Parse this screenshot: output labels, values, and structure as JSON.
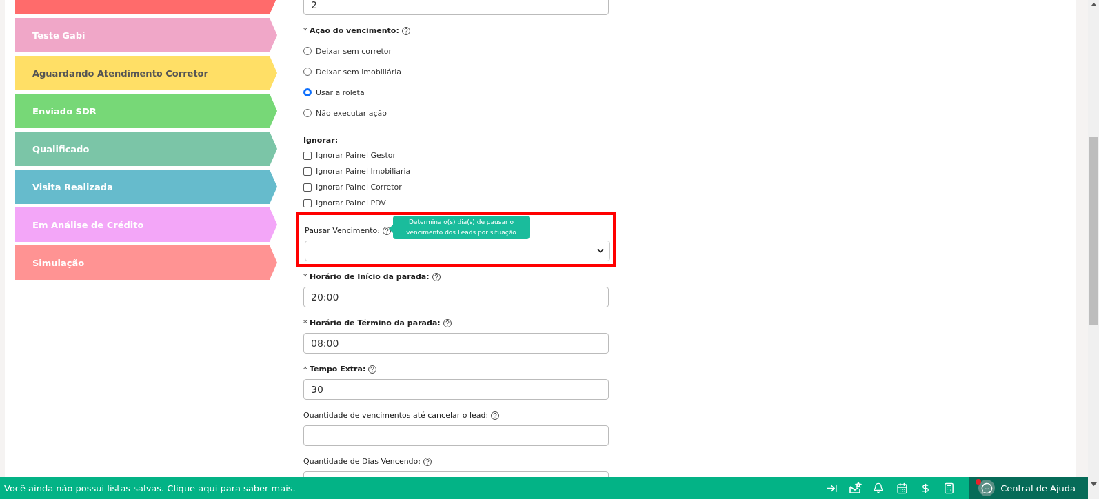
{
  "sidebar": {
    "items": [
      {
        "color": "#ff6b6b"
      },
      {
        "label": "Teste Gabi",
        "color": "#f0a7c8"
      },
      {
        "label": "Aguardando Atendimento Corretor",
        "color": "#ffdf66"
      },
      {
        "label": "Enviado SDR",
        "color": "#77d877"
      },
      {
        "label": "Qualificado",
        "color": "#7bc5a7"
      },
      {
        "label": "Visita Realizada",
        "color": "#66bbcc"
      },
      {
        "label": "Em Análise de Crédito",
        "color": "#f3a6f8"
      },
      {
        "label": "Simulação",
        "color": "#ff9393"
      }
    ]
  },
  "form": {
    "top_field": {
      "value": "2"
    },
    "action": {
      "required_mark": "*",
      "label": "Ação do vencimento:",
      "options": [
        {
          "label": "Deixar sem corretor",
          "selected": false
        },
        {
          "label": "Deixar sem imobiliária",
          "selected": false
        },
        {
          "label": "Usar a roleta",
          "selected": true
        },
        {
          "label": "Não executar ação",
          "selected": false
        }
      ]
    },
    "ignore": {
      "label": "Ignorar:",
      "options": [
        {
          "label": "Ignorar Painel Gestor",
          "checked": false
        },
        {
          "label": "Ignorar Painel Imobiliaria",
          "checked": false
        },
        {
          "label": "Ignorar Painel Corretor",
          "checked": false
        },
        {
          "label": "Ignorar Painel PDV",
          "checked": false
        }
      ]
    },
    "pause": {
      "label": "Pausar Vencimento:",
      "tooltip": "Determina o(s) dia(s) de pausar o vencimento dos Leads por situação",
      "highlighted": true
    },
    "fields": [
      {
        "required_mark": "*",
        "label": "Horário de Início da parada:",
        "value": "20:00"
      },
      {
        "required_mark": "*",
        "label": "Horário de Término da parada:",
        "value": "08:00"
      },
      {
        "required_mark": "*",
        "label": "Tempo Extra:",
        "value": "30"
      },
      {
        "label": "Quantidade de vencimentos até cancelar o lead:"
      },
      {
        "label": "Quantidade de Dias Vencendo:"
      }
    ]
  },
  "footer": {
    "message": "Você ainda não possui listas salvas. Clique aqui para saber mais.",
    "help_label": "Central de Ajuda",
    "help_alert": true
  }
}
